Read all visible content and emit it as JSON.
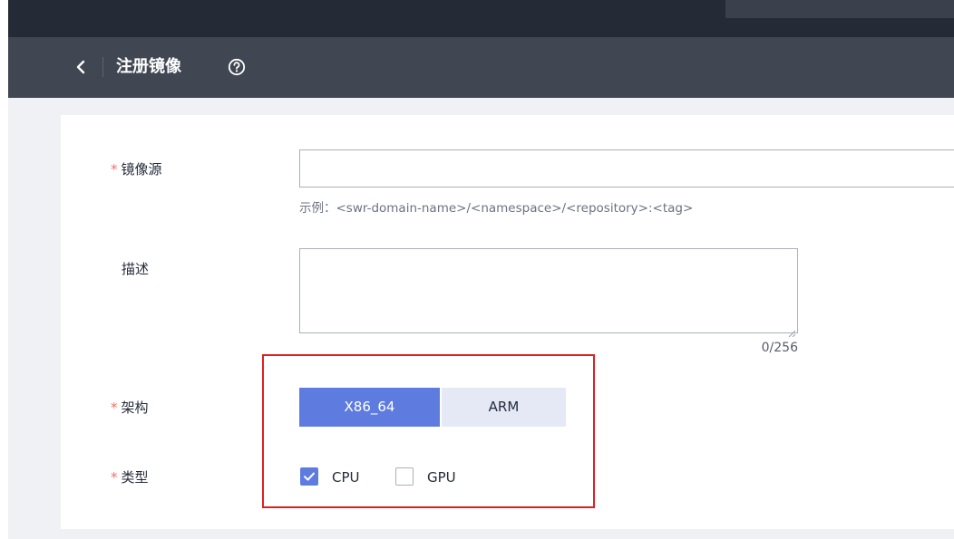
{
  "header": {
    "title": "注册镜像",
    "back_icon": "chevron-left-icon",
    "help_icon": "question-circle-icon"
  },
  "form": {
    "image_source": {
      "required_mark": "*",
      "label": "镜像源",
      "value": "",
      "hint": "示例：<swr-domain-name>/<namespace>/<repository>:<tag>"
    },
    "description": {
      "label": "描述",
      "value": "",
      "counter": "0/256"
    },
    "architecture": {
      "required_mark": "*",
      "label": "架构",
      "options": [
        "X86_64",
        "ARM"
      ],
      "selected": "X86_64"
    },
    "type": {
      "required_mark": "*",
      "label": "类型",
      "options": [
        {
          "label": "CPU",
          "checked": true
        },
        {
          "label": "GPU",
          "checked": false
        }
      ]
    }
  },
  "colors": {
    "accent": "#5e7ce0",
    "required": "#f66f6a",
    "header_bg": "#404753",
    "topbar_bg": "#252b36",
    "highlight_box": "#e02020"
  }
}
